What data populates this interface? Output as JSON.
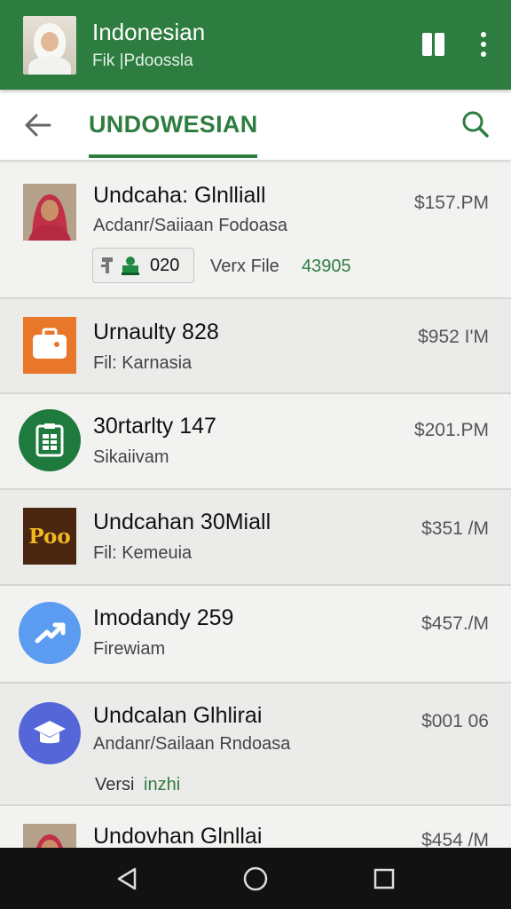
{
  "header": {
    "title": "Indonesian",
    "subtitle": "Fik |Pdoossla"
  },
  "subheader": {
    "title": "UNDOWESIAN"
  },
  "items": [
    {
      "title": "Undcaha: Glnlliall",
      "subtitle": "Acdanr/Saiiaan Fodoasa",
      "price": "$157.PM",
      "chip_label": "020",
      "version_label": "Verx File",
      "version_value": "43905"
    },
    {
      "title": "Urnaulty 828",
      "subtitle": "Fil: Karnasia",
      "price": "$952 I'M"
    },
    {
      "title": "30rtarlty 147",
      "subtitle": "Sikaiivam",
      "price": "$201.PM"
    },
    {
      "title": "Undcahan 30Miall",
      "subtitle": "Fil: Kemeuia",
      "price": "$351 /M",
      "logo_text": "Poo"
    },
    {
      "title": "Imodandy 259",
      "subtitle": "Firewiam",
      "price": "$457./M"
    },
    {
      "title": "Undcalan Glhlirai",
      "subtitle": "Andanr/Sailaan Rndoasa",
      "price": "$001 06",
      "version_label": "Versi",
      "version_value": "inzhi"
    },
    {
      "title": "Undovhan Glnllai",
      "price": "$454 /M"
    }
  ],
  "colors": {
    "accent": "#2e7d40",
    "orange": "#e8772a",
    "dark_green": "#1f7a3e",
    "blue": "#5b9cf0",
    "indigo": "#5566d8"
  }
}
